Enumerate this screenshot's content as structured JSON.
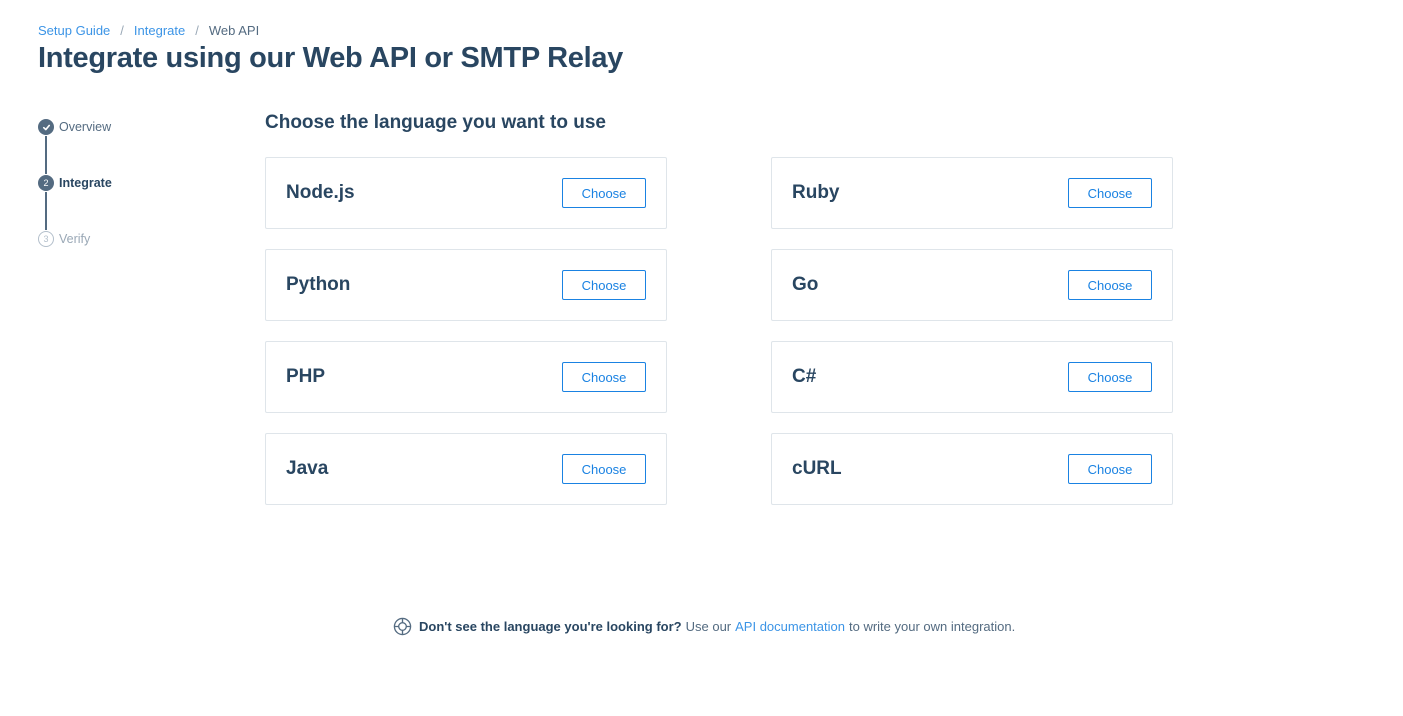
{
  "breadcrumb": {
    "items": [
      "Setup Guide",
      "Integrate"
    ],
    "current": "Web API",
    "separator": "/"
  },
  "page_title": "Integrate using our Web API or SMTP Relay",
  "stepper": {
    "steps": [
      {
        "number": "✓",
        "label": "Overview",
        "state": "done"
      },
      {
        "number": "2",
        "label": "Integrate",
        "state": "active"
      },
      {
        "number": "3",
        "label": "Verify",
        "state": "pending"
      }
    ]
  },
  "section_title": "Choose the language you want to use",
  "languages": [
    {
      "name": "Node.js",
      "button": "Choose"
    },
    {
      "name": "Ruby",
      "button": "Choose"
    },
    {
      "name": "Python",
      "button": "Choose"
    },
    {
      "name": "Go",
      "button": "Choose"
    },
    {
      "name": "PHP",
      "button": "Choose"
    },
    {
      "name": "C#",
      "button": "Choose"
    },
    {
      "name": "Java",
      "button": "Choose"
    },
    {
      "name": "cURL",
      "button": "Choose"
    }
  ],
  "footer": {
    "icon": "lifebuoy-icon",
    "question": "Don't see the language you're looking for?",
    "prefix": "Use our",
    "link": "API documentation",
    "suffix": "to write your own integration."
  },
  "colors": {
    "primary_text": "#294661",
    "accent": "#1a82e2",
    "border": "#dfe5ea"
  }
}
